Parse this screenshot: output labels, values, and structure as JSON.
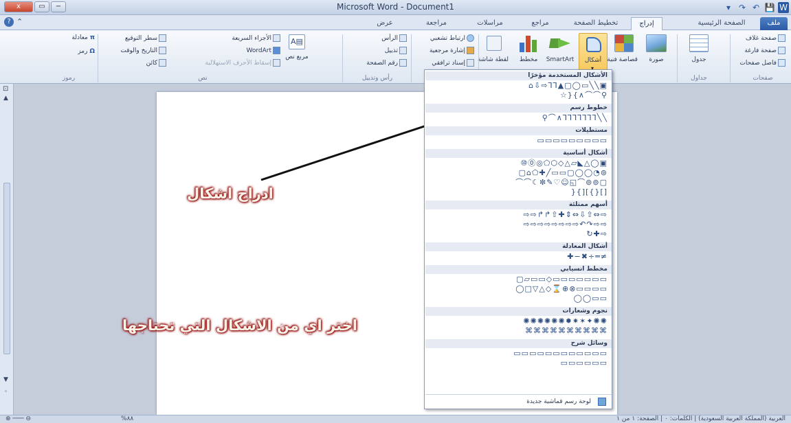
{
  "window": {
    "title": "Microsoft Word - Document1",
    "close_label": "x",
    "quick_access": [
      "W",
      "💾",
      "↶",
      "↷",
      "▾"
    ]
  },
  "tabs": [
    "ملف",
    "الصفحة الرئيسية",
    "إدراج",
    "تخطيط الصفحة",
    "مراجع",
    "مراسلات",
    "مراجعة",
    "عرض"
  ],
  "active_tab": "إدراج",
  "ribbon": {
    "pages": [
      "صفحة غلاف",
      "صفحة فارغة",
      "فاصل صفحات"
    ],
    "pages_group": "صفحات",
    "table": "جدول",
    "tables_group": "جداول",
    "picture": "صورة",
    "clipart": "قصاصة فنية",
    "shapes": "أشكال",
    "smartart": "SmartArt",
    "chart": "مخطط",
    "screenshot": "لقطة شاشة",
    "links": [
      "ارتباط تشعبي",
      "إشارة مرجعية",
      "إسناد ترافقي"
    ],
    "header_footer": [
      "الرأس",
      "تذييل",
      "رقم الصفحة"
    ],
    "header_footer_group": "رأس وتذييل",
    "text_box": "مربع نص",
    "text_items": [
      "الأجزاء السريعة",
      "WordArt",
      "إسقاط الأحرف الاستهلالية"
    ],
    "text_items2": [
      "سطر التوقيع",
      "التاريخ والوقت",
      "كائن"
    ],
    "text_group": "نص",
    "symbols": [
      "معادلة",
      "رمز"
    ],
    "symbols_group": "رموز"
  },
  "gallery": {
    "sections": [
      {
        "title": "الأشكال المستخدمة مؤخرًا",
        "rows": [
          "⌂⇩⇨⅂⅂▲▢◯▭╲╲▣",
          "☆}{∧⌒⌒⚲"
        ]
      },
      {
        "title": "خطوط رسم",
        "rows": [
          "⚲⌒∧⅂⅂⅂⅂⅂⅂⅂╲╲"
        ]
      },
      {
        "title": "مستطيلات",
        "rows": [
          "▭▭▭▭▭▭▭▭▭"
        ]
      },
      {
        "title": "أشكال أساسية",
        "rows": [
          "⑩⓪◎⬠⬡◇△▱◣△◯▣",
          "▢⌂⬠✚╱▭▭▢◯◯◔⊚",
          "⌒⌒☾✼✎♡☺◱⌒⊚⊚▢",
          "}{][{}[]"
        ]
      },
      {
        "title": "أسهم ممتلئة",
        "rows": [
          "⇨⇨↱↱⇧✚⇕⇔⇩⇧⇔⇨",
          "⇨⇨⇨⇨⇨⇨⇨⇨↶↷⇨⇨",
          "↻✚⇨"
        ]
      },
      {
        "title": "أشكال المعادلة",
        "rows": [
          "✚−✖÷═≠"
        ]
      },
      {
        "title": "مخطط انسيابي",
        "rows": [
          "▢▱▭▭◇▭▭▭▭▭▭▭",
          "◯□▽△◇⌛⊕⊗▭▭▭▭",
          "◯◯▭▭"
        ]
      },
      {
        "title": "نجوم وشعارات",
        "rows": [
          "✺✺✺✺✺✺✹✷✶✦✺✺",
          "⌘⌘⌘⌘⌘⌘⌘⌘⌘⌘"
        ]
      },
      {
        "title": "وسائل شرح",
        "rows": [
          "▭▭▭▭▭▭▭▭▭▭▭▭",
          "▭▭▭▭▭▭"
        ]
      }
    ],
    "new_canvas": "لوحة رسم قماشية جديدة"
  },
  "callouts": {
    "insert_shapes": "ادراج اشكال",
    "choose_shape": "اختر اي من الاشكال التي تحتاجها"
  },
  "status": {
    "left_text": "%٨٨",
    "right_text": "العربية (المملكة العربية السعودية)   |   الكلمات: ٠   |   الصفحة: ١ من ١"
  }
}
